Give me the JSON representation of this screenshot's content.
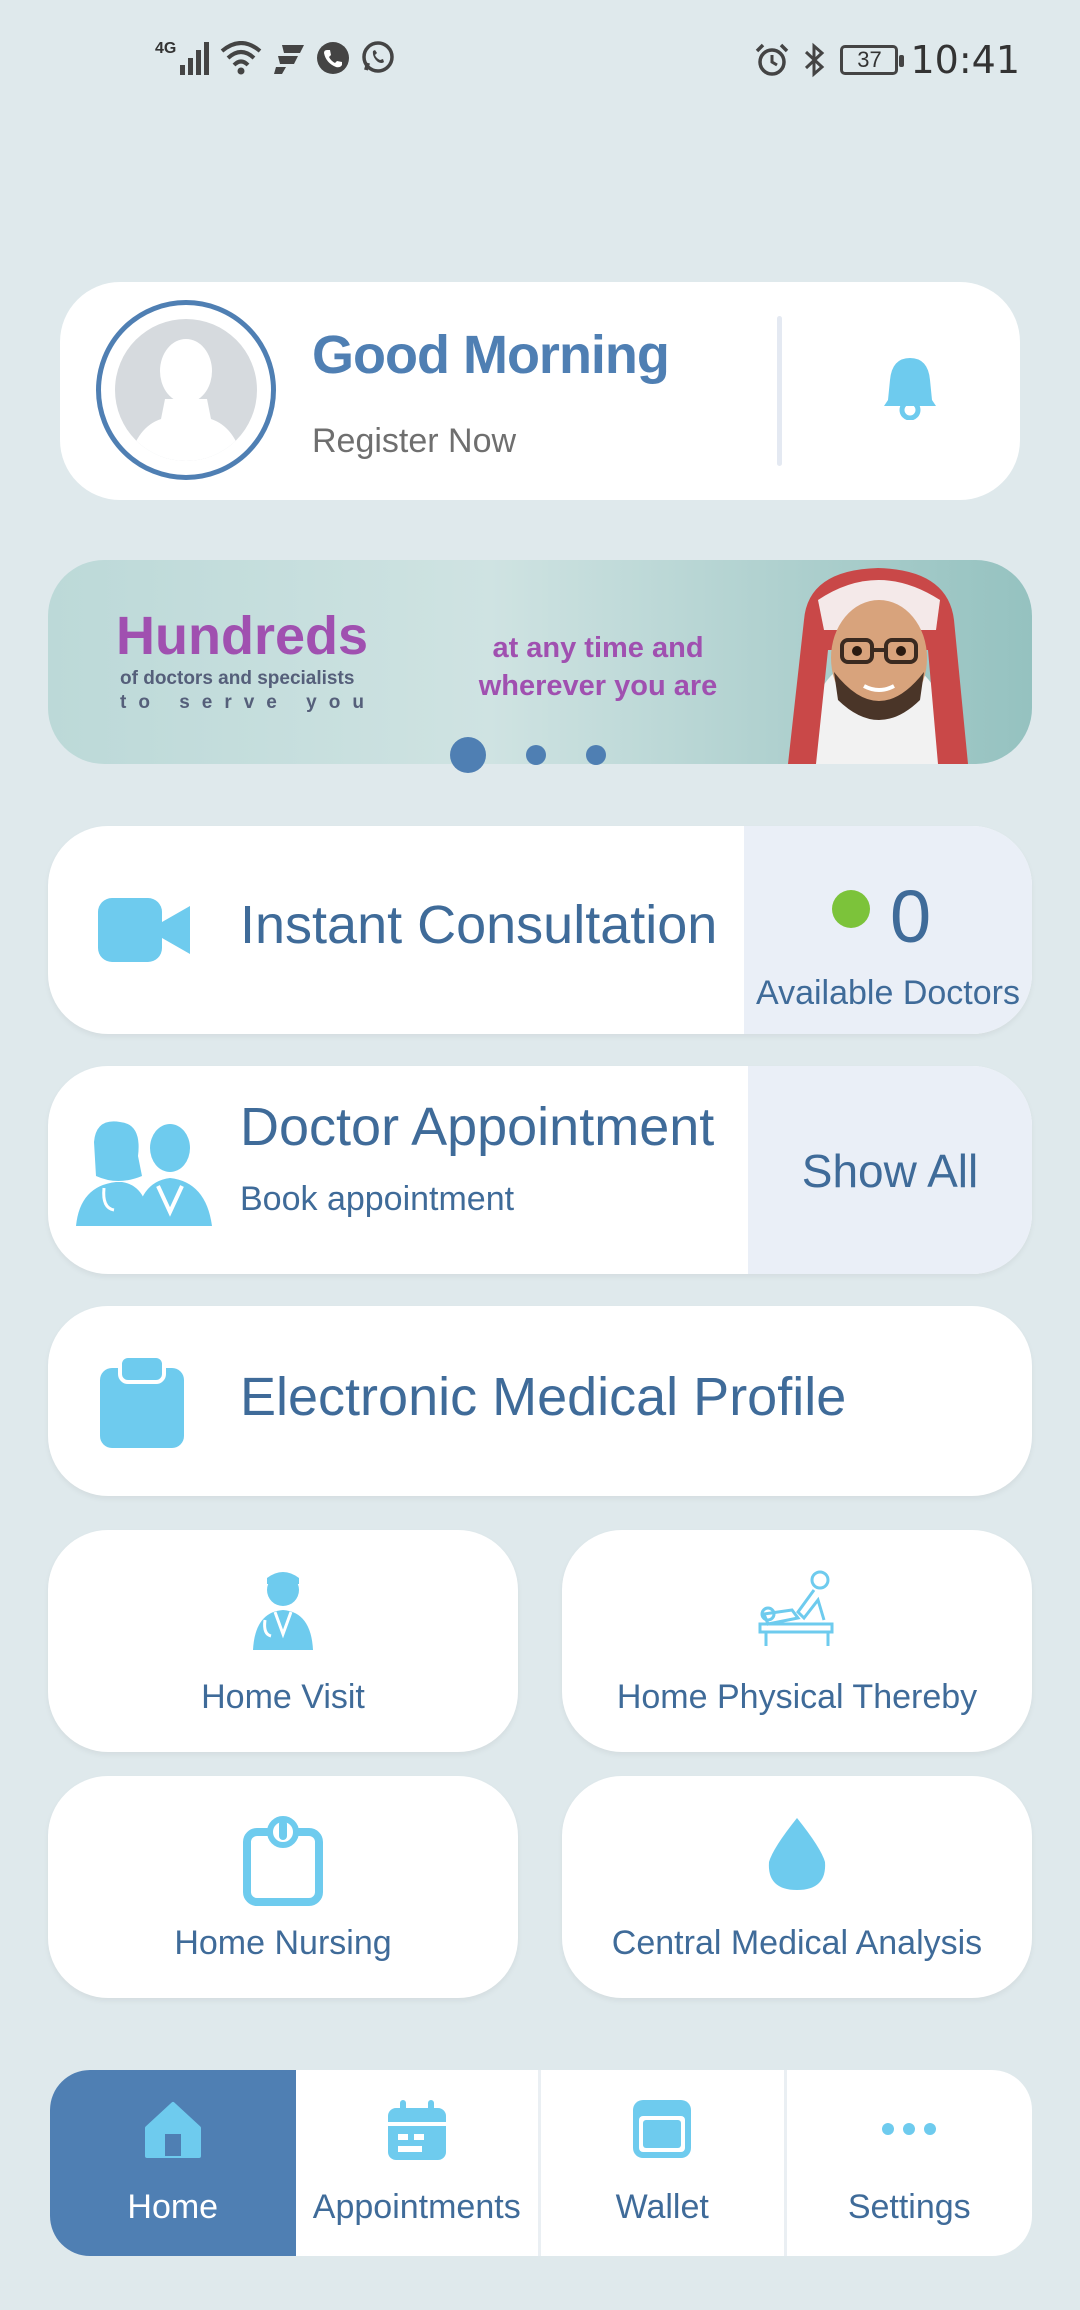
{
  "status_bar": {
    "network": "4G",
    "battery": "37",
    "time": "10:41"
  },
  "header": {
    "greeting": "Good Morning",
    "register": "Register Now"
  },
  "banner": {
    "headline": "Hundreds",
    "line1": "of doctors and specialists",
    "line2": "to serve you",
    "tag1": "at any time and",
    "tag2": "wherever you are",
    "slides": 3,
    "active_slide": 1
  },
  "instant_consultation": {
    "label": "Instant Consultation",
    "available_count": "0",
    "available_label": "Available Doctors",
    "status_color": "#7cc33a"
  },
  "doctor_appointment": {
    "title": "Doctor Appointment",
    "subtitle": "Book appointment",
    "action": "Show All"
  },
  "medical_profile": {
    "label": "Electronic Medical Profile"
  },
  "services": [
    {
      "label": "Home Visit",
      "icon": "doctor-icon"
    },
    {
      "label": "Home Physical Thereby",
      "icon": "physiotherapy-icon"
    },
    {
      "label": "Home Nursing",
      "icon": "clipboard-icon"
    },
    {
      "label": "Central Medical Analysis",
      "icon": "blood-drop-icon"
    }
  ],
  "nav": {
    "items": [
      {
        "label": "Home",
        "icon": "home-icon",
        "active": true
      },
      {
        "label": "Appointments",
        "icon": "calendar-icon",
        "active": false
      },
      {
        "label": "Wallet",
        "icon": "wallet-icon",
        "active": false
      },
      {
        "label": "Settings",
        "icon": "more-icon",
        "active": false
      }
    ]
  },
  "colors": {
    "background": "#dfe9ec",
    "primary": "#4f7fb3",
    "text": "#3f6b99",
    "icon_accent": "#6ecbee",
    "banner_purple": "#a050b0"
  }
}
